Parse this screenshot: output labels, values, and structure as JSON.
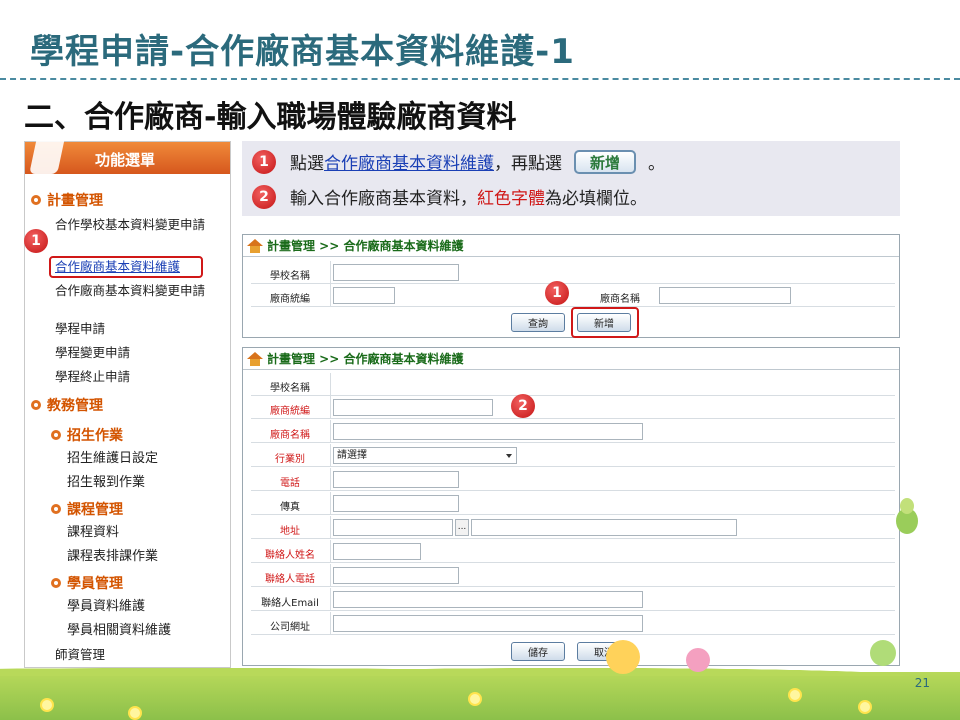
{
  "slide": {
    "title": "學程申請-合作廠商基本資料維護-1",
    "subtitle": "二、合作廠商-輸入職場體驗廠商資料",
    "page_number": "21"
  },
  "menu": {
    "header": "功能選單",
    "sections": [
      {
        "label": "計畫管理"
      },
      {
        "label": "教務管理"
      }
    ],
    "items": {
      "i1": "合作學校基本資料變更申請",
      "i2": "合作廠商基本資料維護",
      "i3": "合作廠商基本資料變更申請",
      "i4": "學程申請",
      "i5": "學程變更申請",
      "i6": "學程終止申請"
    },
    "subsections": {
      "s1": "招生作業",
      "s2": "課程管理",
      "s3": "學員管理"
    },
    "subitems": {
      "a1": "招生維護日設定",
      "a2": "招生報到作業",
      "b1": "課程資料",
      "b2": "課程表排課作業",
      "c1": "學員資料維護",
      "c2": "學員相關資料維護"
    },
    "last_item": "師資管理"
  },
  "badges": {
    "one": "1",
    "two": "2"
  },
  "instructions": {
    "line1_pre": "點選",
    "line1_link": "合作廠商基本資料維護",
    "line1_mid": "，再點選",
    "line1_chip": "新增",
    "line1_post": "。",
    "line2_pre": "輸入合作廠商基本資料，",
    "line2_red": "紅色字體",
    "line2_post": "為必填欄位。"
  },
  "search_panel": {
    "breadcrumb": "計畫管理 >> 合作廠商基本資料維護",
    "school_name_label": "學校名稱",
    "vendor_id_label": "廠商統編",
    "vendor_name_label": "廠商名稱",
    "query_button": "查詢",
    "add_button": "新增"
  },
  "form_panel": {
    "breadcrumb": "計畫管理 >> 合作廠商基本資料維護",
    "labels": {
      "school_name": "學校名稱",
      "vendor_id": "廠商統編",
      "vendor_name": "廠商名稱",
      "industry": "行業別",
      "phone": "電話",
      "fax": "傳真",
      "address": "地址",
      "contact_name": "聯絡人姓名",
      "contact_phone": "聯絡人電話",
      "contact_email": "聯絡人Email",
      "website": "公司網址"
    },
    "industry_select_value": "請選擇",
    "address_button": "...",
    "save_button": "儲存",
    "cancel_button": "取消"
  }
}
